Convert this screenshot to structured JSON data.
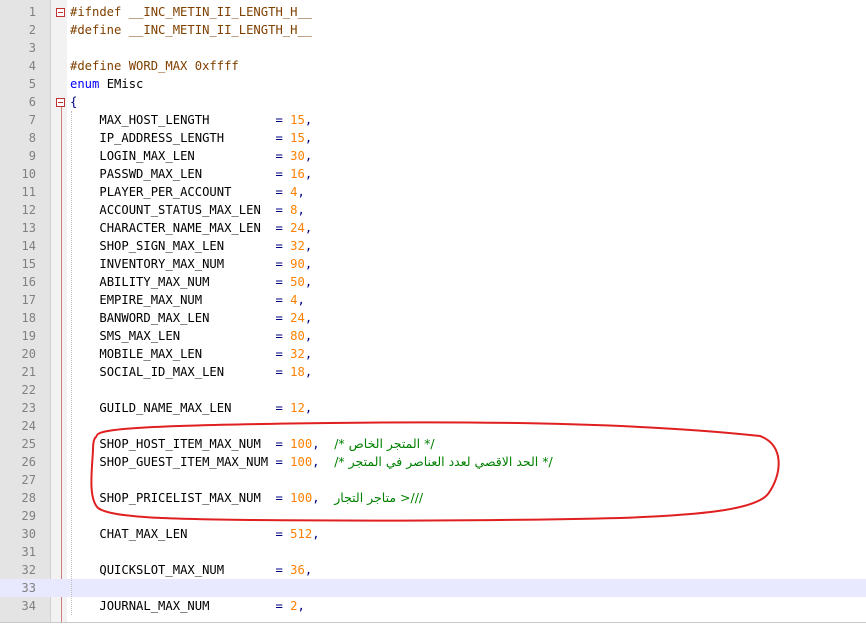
{
  "editor": {
    "current_line": "33",
    "lines": [
      {
        "no": "1",
        "a": "#ifndef __INC_METIN_II_LENGTH_H__"
      },
      {
        "no": "2",
        "a": "#define __INC_METIN_II_LENGTH_H__"
      },
      {
        "no": "3"
      },
      {
        "no": "4",
        "a": "#define WORD_MAX 0xffff"
      },
      {
        "no": "5",
        "k": "enum",
        "b": "EMisc"
      },
      {
        "no": "6",
        "a": "{"
      },
      {
        "no": "7",
        "n": "MAX_HOST_LENGTH",
        "v": "15"
      },
      {
        "no": "8",
        "n": "IP_ADDRESS_LENGTH",
        "v": "15"
      },
      {
        "no": "9",
        "n": "LOGIN_MAX_LEN",
        "v": "30"
      },
      {
        "no": "10",
        "n": "PASSWD_MAX_LEN",
        "v": "16"
      },
      {
        "no": "11",
        "n": "PLAYER_PER_ACCOUNT",
        "v": "4"
      },
      {
        "no": "12",
        "n": "ACCOUNT_STATUS_MAX_LEN",
        "v": "8"
      },
      {
        "no": "13",
        "n": "CHARACTER_NAME_MAX_LEN",
        "v": "24"
      },
      {
        "no": "14",
        "n": "SHOP_SIGN_MAX_LEN",
        "v": "32"
      },
      {
        "no": "15",
        "n": "INVENTORY_MAX_NUM",
        "v": "90"
      },
      {
        "no": "16",
        "n": "ABILITY_MAX_NUM",
        "v": "50"
      },
      {
        "no": "17",
        "n": "EMPIRE_MAX_NUM",
        "v": "4"
      },
      {
        "no": "18",
        "n": "BANWORD_MAX_LEN",
        "v": "24"
      },
      {
        "no": "19",
        "n": "SMS_MAX_LEN",
        "v": "80"
      },
      {
        "no": "20",
        "n": "MOBILE_MAX_LEN",
        "v": "32"
      },
      {
        "no": "21",
        "n": "SOCIAL_ID_MAX_LEN",
        "v": "18"
      },
      {
        "no": "22"
      },
      {
        "no": "23",
        "n": "GUILD_NAME_MAX_LEN",
        "v": "12"
      },
      {
        "no": "24"
      },
      {
        "no": "25",
        "n": "SHOP_HOST_ITEM_MAX_NUM",
        "v": "100",
        "c": "/* المتجر الخاص */"
      },
      {
        "no": "26",
        "n": "SHOP_GUEST_ITEM_MAX_NUM",
        "v": "100",
        "c": "/* الحد الاقصي لعدد العناصر في المتجر */"
      },
      {
        "no": "27"
      },
      {
        "no": "28",
        "n": "SHOP_PRICELIST_MAX_NUM",
        "v": "100",
        "c": "///< متاجر التجار"
      },
      {
        "no": "29"
      },
      {
        "no": "30",
        "n": "CHAT_MAX_LEN",
        "v": "512"
      },
      {
        "no": "31"
      },
      {
        "no": "32",
        "n": "QUICKSLOT_MAX_NUM",
        "v": "36"
      },
      {
        "no": "33"
      },
      {
        "no": "34",
        "n": "JOURNAL_MAX_NUM",
        "v": "2"
      }
    ]
  },
  "annotation": {
    "color": "#e02020"
  }
}
